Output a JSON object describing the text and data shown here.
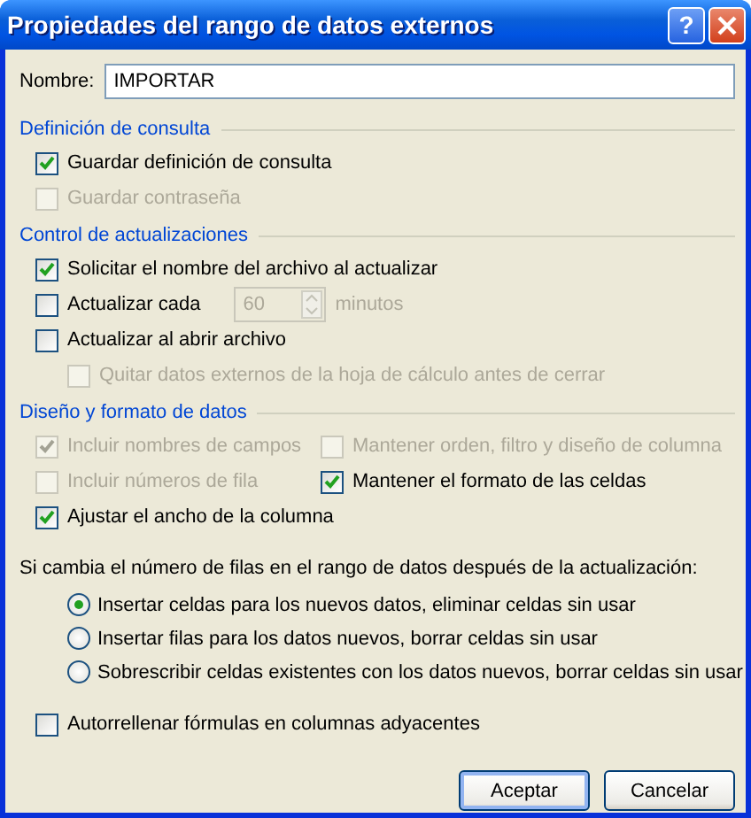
{
  "window": {
    "title": "Propiedades del rango de datos externos",
    "buttons": [
      {
        "kind": "help",
        "label": "?"
      },
      {
        "kind": "close"
      }
    ]
  },
  "name_field": {
    "label": "Nombre:",
    "value": "IMPORTAR"
  },
  "sections": [
    {
      "title": "Definición de consulta",
      "rows": [
        [
          {
            "kind": "checkbox",
            "label": "Guardar definición de consulta",
            "checked": true,
            "disabled": false
          }
        ],
        [
          {
            "kind": "checkbox",
            "label": "Guardar contraseña",
            "checked": false,
            "disabled": true
          }
        ]
      ]
    },
    {
      "title": "Control de actualizaciones",
      "rows": [
        [
          {
            "kind": "checkbox",
            "label": "Solicitar el nombre del archivo al actualizar",
            "checked": true,
            "disabled": false
          }
        ],
        [
          {
            "kind": "interval",
            "label": "Actualizar cada",
            "checked": false,
            "disabled": false,
            "value": "60",
            "unit": "minutos"
          }
        ],
        [
          {
            "kind": "checkbox",
            "label": "Actualizar al abrir archivo",
            "checked": false,
            "disabled": false,
            "children": [
              {
                "kind": "checkbox",
                "label": "Quitar datos externos de la hoja de cálculo antes de cerrar",
                "checked": false,
                "disabled": true
              }
            ]
          }
        ]
      ]
    },
    {
      "title": "Diseño y formato de datos",
      "rows": [
        [
          {
            "kind": "checkbox",
            "label": "Incluir nombres de campos",
            "checked": true,
            "disabled": true
          },
          {
            "kind": "checkbox",
            "label": "Mantener orden, filtro y diseño de columna",
            "checked": false,
            "disabled": true
          }
        ],
        [
          {
            "kind": "checkbox",
            "label": "Incluir números de fila",
            "checked": false,
            "disabled": true
          },
          {
            "kind": "checkbox",
            "label": "Mantener el formato de las celdas",
            "checked": true,
            "disabled": false
          }
        ],
        [
          {
            "kind": "checkbox",
            "label": "Ajustar el ancho de la columna",
            "checked": true,
            "disabled": false
          }
        ]
      ]
    }
  ],
  "row_change": {
    "prompt": "Si cambia el número de filas en el rango de datos después de la actualización:",
    "options": [
      {
        "label": "Insertar celdas para los nuevos datos, eliminar celdas sin usar",
        "selected": true
      },
      {
        "label": "Insertar filas para los datos nuevos, borrar celdas sin usar",
        "selected": false
      },
      {
        "label": "Sobrescribir celdas existentes con los datos nuevos, borrar celdas sin usar",
        "selected": false
      }
    ]
  },
  "autofill": {
    "label": "Autorrellenar fórmulas en columnas adyacentes",
    "checked": false
  },
  "buttons": [
    {
      "label": "Aceptar",
      "default": true
    },
    {
      "label": "Cancelar",
      "default": false
    }
  ]
}
